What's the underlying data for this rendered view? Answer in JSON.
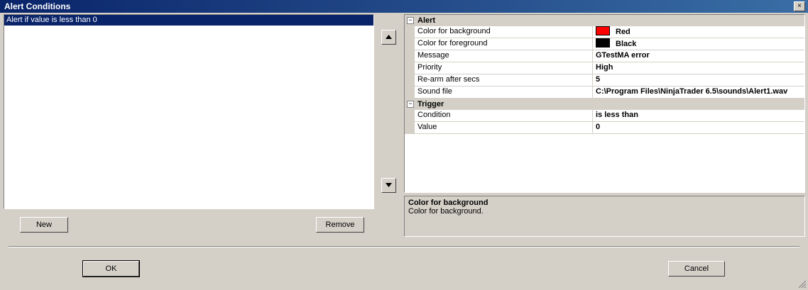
{
  "window": {
    "title": "Alert Conditions",
    "close_glyph": "×"
  },
  "conditions_list": {
    "items": [
      "Alert if value is less than 0"
    ]
  },
  "buttons": {
    "new": "New",
    "remove": "Remove",
    "ok": "OK",
    "cancel": "Cancel"
  },
  "properties": {
    "categories": [
      {
        "name": "Alert",
        "expander": "−",
        "rows": [
          {
            "name": "Color for background",
            "value": "Red",
            "swatch": "#ff0000"
          },
          {
            "name": "Color for foreground",
            "value": "Black",
            "swatch": "#000000"
          },
          {
            "name": "Message",
            "value": "GTestMA error"
          },
          {
            "name": "Priority",
            "value": "High"
          },
          {
            "name": "Re-arm after secs",
            "value": "5"
          },
          {
            "name": "Sound file",
            "value": "C:\\Program Files\\NinjaTrader 6.5\\sounds\\Alert1.wav"
          }
        ]
      },
      {
        "name": "Trigger",
        "expander": "−",
        "rows": [
          {
            "name": "Condition",
            "value": "is less than"
          },
          {
            "name": "Value",
            "value": "0"
          }
        ]
      }
    ]
  },
  "description": {
    "title": "Color for background",
    "text": "Color for background."
  }
}
